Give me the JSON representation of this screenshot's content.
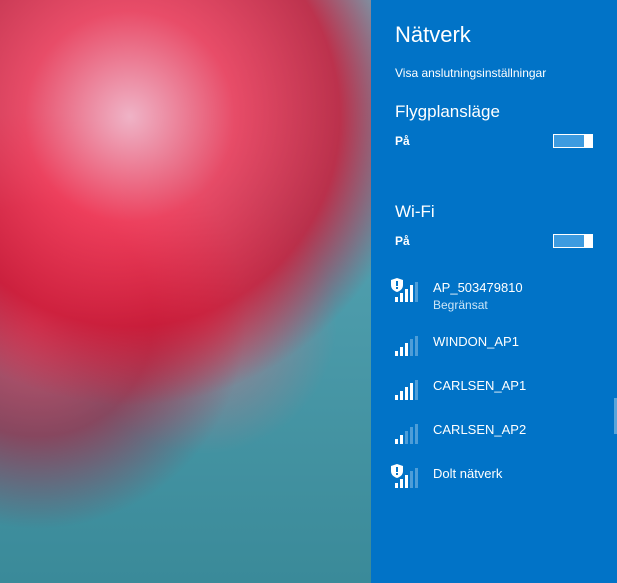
{
  "panel": {
    "title": "Nätverk",
    "settings_link": "Visa anslutningsinställningar",
    "airplane": {
      "label": "Flygplansläge",
      "state": "På"
    },
    "wifi": {
      "label": "Wi-Fi",
      "state": "På"
    },
    "networks": [
      {
        "name": "AP_503479810",
        "sub": "Begränsat",
        "strength": 4,
        "shield": true
      },
      {
        "name": "WINDON_AP1",
        "sub": "",
        "strength": 3,
        "shield": false
      },
      {
        "name": "CARLSEN_AP1",
        "sub": "",
        "strength": 4,
        "shield": false
      },
      {
        "name": "CARLSEN_AP2",
        "sub": "",
        "strength": 2,
        "shield": false
      },
      {
        "name": "Dolt nätverk",
        "sub": "",
        "strength": 3,
        "shield": true
      }
    ]
  }
}
